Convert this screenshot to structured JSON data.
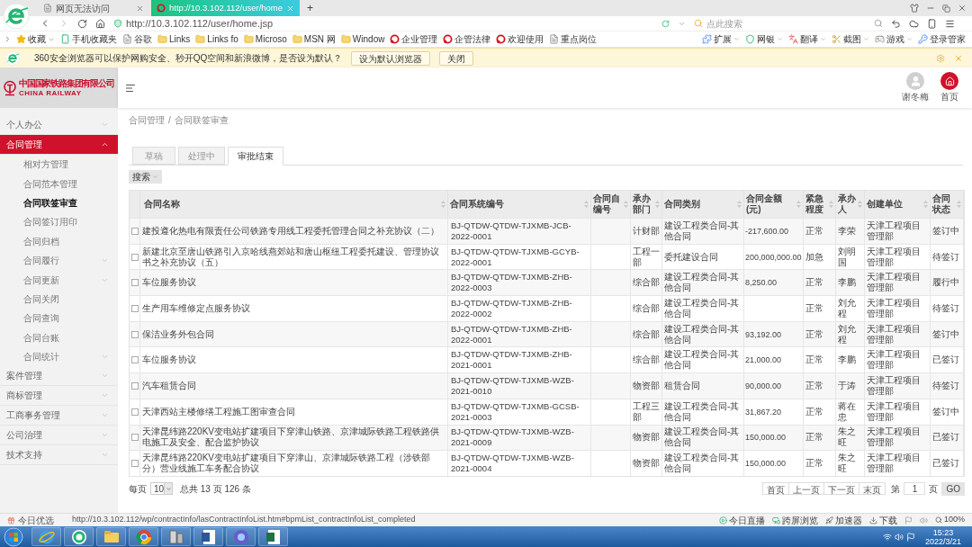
{
  "browser": {
    "tabs": [
      {
        "label": "网页无法访问",
        "selected": false
      },
      {
        "label": "http://10.3.102.112/user/home",
        "selected": true
      }
    ],
    "new_tab": "+",
    "url": "http://10.3.102.112/user/home.jsp",
    "search": {
      "placeholder": "点此搜索"
    },
    "bookmarks": [
      {
        "label": "收藏",
        "kind": "star"
      },
      {
        "label": "手机收藏夹",
        "kind": "phone"
      },
      {
        "label": "谷歌",
        "kind": "page"
      },
      {
        "label": "Links",
        "kind": "folder"
      },
      {
        "label": "Links fo",
        "kind": "folder"
      },
      {
        "label": "Microso",
        "kind": "folder"
      },
      {
        "label": "MSN 网",
        "kind": "folder"
      },
      {
        "label": "Window",
        "kind": "folder"
      },
      {
        "label": "企业管理",
        "kind": "site"
      },
      {
        "label": "企管法律",
        "kind": "site"
      },
      {
        "label": "欢迎使用",
        "kind": "site"
      },
      {
        "label": "重点岗位",
        "kind": "page"
      }
    ],
    "tools": [
      "扩展",
      "网银",
      "翻译",
      "截图",
      "游戏",
      "登录管家"
    ],
    "infobar": {
      "message": "360安全浏览器可以保护网购安全、秒开QQ空间和新浪微博，是否设为默认？",
      "buttons": [
        "设为默认浏览器",
        "关闭"
      ]
    }
  },
  "app": {
    "logo": {
      "name_cn": "中国国家铁路集团有限公司",
      "name_en": "CHINA RAILWAY"
    },
    "user": "谢冬梅",
    "home": "首页"
  },
  "sidebar": {
    "items": [
      {
        "label": "个人办公",
        "expanded": false,
        "selected": false
      },
      {
        "label": "合同管理",
        "expanded": true,
        "selected": true,
        "children": [
          {
            "label": "相对方管理",
            "kind": "link",
            "selected": false
          },
          {
            "label": "合同范本管理",
            "kind": "link",
            "selected": false
          },
          {
            "label": "合同联签审查",
            "kind": "link",
            "selected": true
          },
          {
            "label": "合同签订用印",
            "kind": "link",
            "selected": false
          },
          {
            "label": "合同归档",
            "kind": "link",
            "selected": false
          },
          {
            "label": "合同履行",
            "kind": "group",
            "selected": false
          },
          {
            "label": "合同更新",
            "kind": "group",
            "selected": false
          },
          {
            "label": "合同关闭",
            "kind": "link",
            "selected": false
          },
          {
            "label": "合同查询",
            "kind": "link",
            "selected": false
          },
          {
            "label": "合同台账",
            "kind": "link",
            "selected": false
          },
          {
            "label": "合同统计",
            "kind": "group",
            "selected": false
          }
        ]
      },
      {
        "label": "案件管理",
        "expanded": false,
        "selected": false
      },
      {
        "label": "商标管理",
        "expanded": false,
        "selected": false
      },
      {
        "label": "工商事务管理",
        "expanded": false,
        "selected": false
      },
      {
        "label": "公司治理",
        "expanded": false,
        "selected": false
      },
      {
        "label": "技术支持",
        "expanded": false,
        "selected": false
      }
    ]
  },
  "breadcrumb": {
    "items": [
      "合同管理",
      "合同联签审查"
    ],
    "separator": "/"
  },
  "tabs": [
    {
      "label": "草稿",
      "selected": false
    },
    {
      "label": "处理中",
      "selected": false
    },
    {
      "label": "审批结束",
      "selected": true
    }
  ],
  "search_button": "搜索",
  "table": {
    "columns": [
      "合同名称",
      "合同系统编号",
      "合同自编号",
      "承办部门",
      "合同类别",
      "合同金额(元)",
      "紧急程度",
      "承办人",
      "创建单位",
      "合同状态"
    ],
    "rows": [
      {
        "checked": false,
        "name": "建投遵化热电有限责任公司铁路专用线工程委托管理合同之补充协议（二）",
        "system_no": "BJ-QTDW-QTDW-TJXMB-JCB-2022-0001",
        "dept": "计财部",
        "category": "建设工程类合同-其他合同",
        "amount": "-217,600.00",
        "urgency": "正常",
        "handler": "李荣",
        "unit": "天津工程项目管理部",
        "status": "签订中"
      },
      {
        "checked": false,
        "name": "新建北京至唐山铁路引入京哈线燕郊站和唐山枢纽工程委托建设、管理协议书之补充协议（五）",
        "system_no": "BJ-QTDW-QTDW-TJXMB-GCYB-2022-0001",
        "dept": "工程一部",
        "category": "委托建设合同",
        "amount": "200,000,000.00",
        "urgency": "加急",
        "handler": "刘明国",
        "unit": "天津工程项目管理部",
        "status": "待签订"
      },
      {
        "checked": false,
        "name": "车位服务协议",
        "system_no": "BJ-QTDW-QTDW-TJXMB-ZHB-2022-0003",
        "dept": "综合部",
        "category": "建设工程类合同-其他合同",
        "amount": "8,250.00",
        "urgency": "正常",
        "handler": "李鹏",
        "unit": "天津工程项目管理部",
        "status": "履行中"
      },
      {
        "checked": false,
        "name": "生产用车维修定点服务协议",
        "system_no": "BJ-QTDW-QTDW-TJXMB-ZHB-2022-0002",
        "dept": "综合部",
        "category": "建设工程类合同-其他合同",
        "urgency": "正常",
        "handler": "刘允程",
        "unit": "天津工程项目管理部",
        "status": "待签订"
      },
      {
        "checked": false,
        "name": "保洁业务外包合同",
        "system_no": "BJ-QTDW-QTDW-TJXMB-ZHB-2022-0001",
        "dept": "综合部",
        "category": "建设工程类合同-其他合同",
        "amount": "93,192.00",
        "urgency": "正常",
        "handler": "刘允程",
        "unit": "天津工程项目管理部",
        "status": "签订中"
      },
      {
        "checked": false,
        "name": "车位服务协议",
        "system_no": "BJ-QTDW-QTDW-TJXMB-ZHB-2021-0001",
        "dept": "综合部",
        "category": "建设工程类合同-其他合同",
        "amount": "21,000.00",
        "urgency": "正常",
        "handler": "李鹏",
        "unit": "天津工程项目管理部",
        "status": "已签订"
      },
      {
        "checked": false,
        "name": "汽车租赁合同",
        "system_no": "BJ-QTDW-QTDW-TJXMB-WZB-2021-0010",
        "dept": "物资部",
        "category": "租赁合同",
        "amount": "90,000.00",
        "urgency": "正常",
        "handler": "于涛",
        "unit": "天津工程项目管理部",
        "status": "待签订"
      },
      {
        "checked": false,
        "name": "天津西站主楼修缮工程施工图审查合同",
        "system_no": "BJ-QTDW-QTDW-TJXMB-GCSB-2021-0003",
        "dept": "工程三部",
        "category": "建设工程类合同-其他合同",
        "amount": "31,867.20",
        "urgency": "正常",
        "handler": "蒋在忠",
        "unit": "天津工程项目管理部",
        "status": "签订中"
      },
      {
        "checked": false,
        "name": "天津昆纬路220KV变电站扩建项目下穿津山铁路、京津城际铁路工程铁路供电施工及安全、配合监护协议",
        "system_no": "BJ-QTDW-QTDW-TJXMB-WZB-2021-0009",
        "dept": "物资部",
        "category": "建设工程类合同-其他合同",
        "amount": "150,000.00",
        "urgency": "正常",
        "handler": "朱之旺",
        "unit": "天津工程项目管理部",
        "status": "已签订"
      },
      {
        "checked": false,
        "name": "天津昆纬路220KV变电站扩建项目下穿津山、京津城际铁路工程（涉铁部分）营业线施工车务配合协议",
        "system_no": "BJ-QTDW-QTDW-TJXMB-WZB-2021-0004",
        "dept": "物资部",
        "category": "建设工程类合同-其他合同",
        "amount": "150,000.00",
        "urgency": "正常",
        "handler": "朱之旺",
        "unit": "天津工程项目管理部",
        "status": "已签订"
      }
    ]
  },
  "pagination": {
    "per_page_label": "每页",
    "per_page": "10",
    "total": "总共 13 页 126 条",
    "buttons": [
      "首页",
      "上一页",
      "下一页",
      "末页"
    ],
    "page_label": "第",
    "page": "1",
    "page_suffix": "页",
    "go": "GO"
  },
  "status_bar": {
    "left": "今日优选",
    "url": "http://10.3.102.112/wp/contractInfo/lasContractInfoList.htm#bpmList_contractInfoList_completed",
    "items": [
      "今日直播",
      "跨屏浏览",
      "加速器",
      "下载"
    ],
    "zoom": "100%"
  },
  "taskbar": {
    "time": "15:23",
    "date": "2022/3/21"
  }
}
